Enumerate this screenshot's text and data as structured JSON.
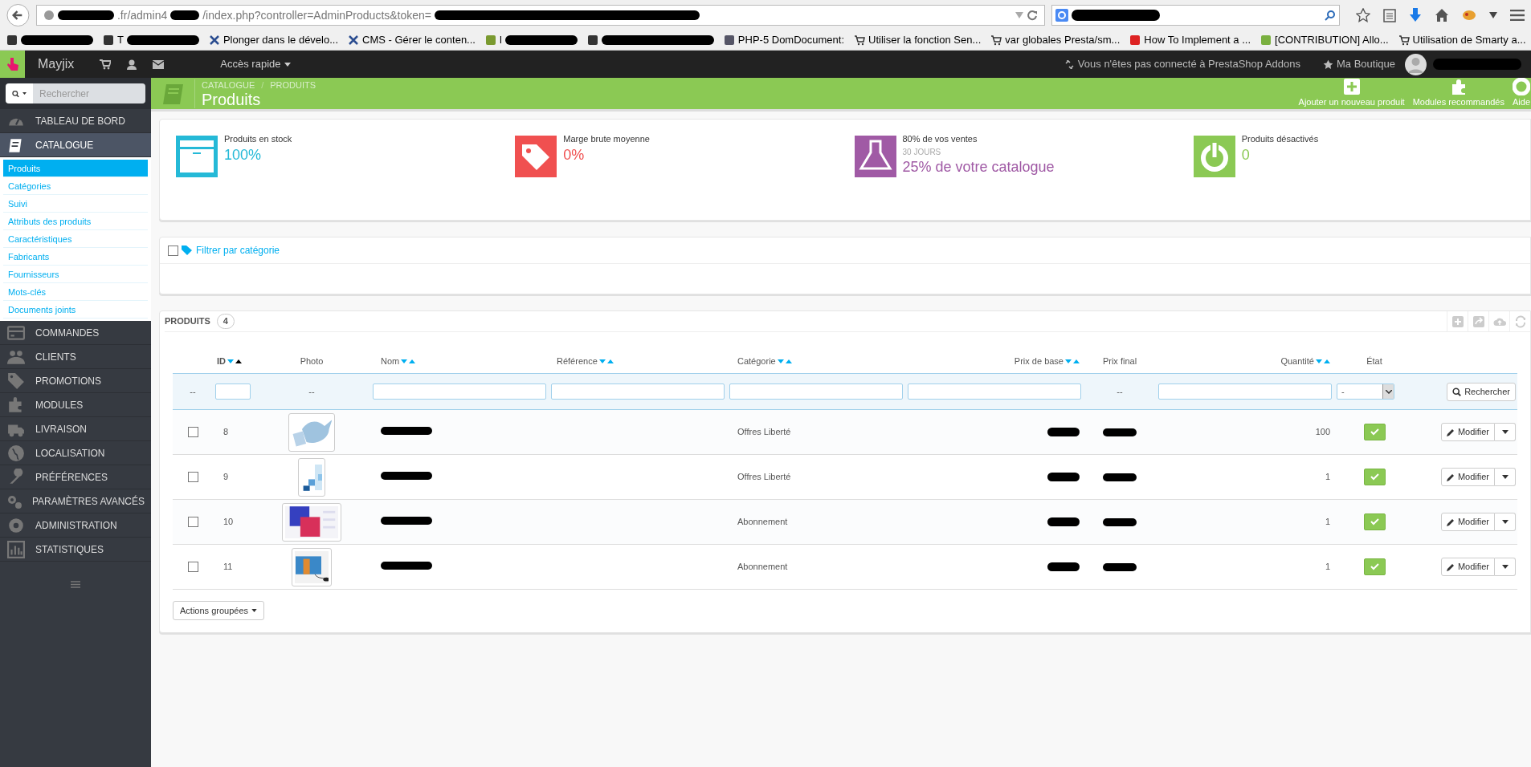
{
  "browser": {
    "url": {
      "shown_parts": [
        ".fr/admin4",
        "/index.php?controller=AdminProducts&token="
      ]
    },
    "bookmarks": [
      {
        "kind": "masked"
      },
      {
        "label": "T",
        "kind": "masked"
      },
      {
        "label": "Plonger dans le dévelo...",
        "kind": "link"
      },
      {
        "label": "CMS - Gérer le conten...",
        "kind": "link"
      },
      {
        "label": "l",
        "kind": "masked"
      },
      {
        "kind": "masked"
      },
      {
        "label": "PHP-5 DomDocument:",
        "kind": "link"
      },
      {
        "label": "Utiliser la fonction Sen...",
        "kind": "link"
      },
      {
        "label": "var globales Presta/sm...",
        "kind": "link"
      },
      {
        "label": "How To Implement a ...",
        "kind": "link"
      },
      {
        "label": "[CONTRIBUTION] Allo...",
        "kind": "link"
      },
      {
        "label": "Utilisation de Smarty a...",
        "kind": "link"
      }
    ]
  },
  "topbar": {
    "shop_name": "Mayjix",
    "quick_access": "Accès rapide",
    "addons_notice": "Vous n'êtes pas connecté à PrestaShop Addons",
    "my_shop": "Ma Boutique"
  },
  "sidebar": {
    "search_placeholder": "Rechercher",
    "items": [
      {
        "label": "TABLEAU DE BORD",
        "selected": false
      },
      {
        "label": "CATALOGUE",
        "selected": true,
        "children": [
          {
            "label": "Produits",
            "selected": true
          },
          {
            "label": "Catégories",
            "selected": false
          },
          {
            "label": "Suivi",
            "selected": false
          },
          {
            "label": "Attributs des produits",
            "selected": false
          },
          {
            "label": "Caractéristiques",
            "selected": false
          },
          {
            "label": "Fabricants",
            "selected": false
          },
          {
            "label": "Fournisseurs",
            "selected": false
          },
          {
            "label": "Mots-clés",
            "selected": false
          },
          {
            "label": "Documents joints",
            "selected": false
          }
        ]
      },
      {
        "label": "COMMANDES",
        "selected": false
      },
      {
        "label": "CLIENTS",
        "selected": false
      },
      {
        "label": "PROMOTIONS",
        "selected": false
      },
      {
        "label": "MODULES",
        "selected": false
      },
      {
        "label": "LIVRAISON",
        "selected": false
      },
      {
        "label": "LOCALISATION",
        "selected": false
      },
      {
        "label": "PRÉFÉRENCES",
        "selected": false
      },
      {
        "label": "PARAMÈTRES AVANCÉS",
        "selected": false
      },
      {
        "label": "ADMINISTRATION",
        "selected": false
      },
      {
        "label": "STATISTIQUES",
        "selected": false
      }
    ]
  },
  "header": {
    "breadcrumb": [
      "CATALOGUE",
      "PRODUITS"
    ],
    "breadcrumb_separator": "/",
    "title": "Produits",
    "actions": [
      "Ajouter un nouveau produit",
      "Modules recommandés",
      "Aide"
    ]
  },
  "kpis": [
    {
      "label": "Produits en stock",
      "value": "100%",
      "color": "#25b9d7"
    },
    {
      "label": "Marge brute moyenne",
      "value": "0%",
      "color": "#f05050"
    },
    {
      "label": "80% de vos ventes",
      "subtitle": "30 JOURS",
      "value": "25% de votre catalogue",
      "color": "#a05aa5"
    },
    {
      "label": "Produits désactivés",
      "value": "0",
      "color": "#8bc954"
    }
  ],
  "category_filter": {
    "label": "Filtrer par catégorie",
    "checked": false
  },
  "products": {
    "title": "PRODUITS",
    "count": "4",
    "columns": [
      {
        "label": "ID",
        "sortable": true,
        "sorted_asc": true
      },
      {
        "label": "Photo",
        "sortable": false
      },
      {
        "label": "Nom",
        "sortable": true,
        "sorted_asc": false
      },
      {
        "label": "Référence",
        "sortable": true,
        "sorted_asc": false
      },
      {
        "label": "Catégorie",
        "sortable": true,
        "sorted_asc": false
      },
      {
        "label": "Prix de base",
        "sortable": true,
        "sorted_asc": false
      },
      {
        "label": "Prix final",
        "sortable": false
      },
      {
        "label": "Quantité",
        "sortable": true,
        "sorted_asc": false
      },
      {
        "label": "État",
        "sortable": false
      }
    ],
    "filter_row": {
      "checkbox_cell": "--",
      "photo_cell": "--",
      "final_price_cell": "--",
      "state_select": "-",
      "search_button": "Rechercher"
    },
    "rows": [
      {
        "id": "8",
        "category": "Offres Liberté",
        "quantity": "100",
        "active": true,
        "checked": false,
        "edit_label": "Modifier"
      },
      {
        "id": "9",
        "category": "Offres Liberté",
        "quantity": "1",
        "active": true,
        "checked": false,
        "edit_label": "Modifier"
      },
      {
        "id": "10",
        "category": "Abonnement",
        "quantity": "1",
        "active": true,
        "checked": false,
        "edit_label": "Modifier"
      },
      {
        "id": "11",
        "category": "Abonnement",
        "quantity": "1",
        "active": true,
        "checked": false,
        "edit_label": "Modifier"
      }
    ],
    "bulk_button": "Actions groupées"
  }
}
